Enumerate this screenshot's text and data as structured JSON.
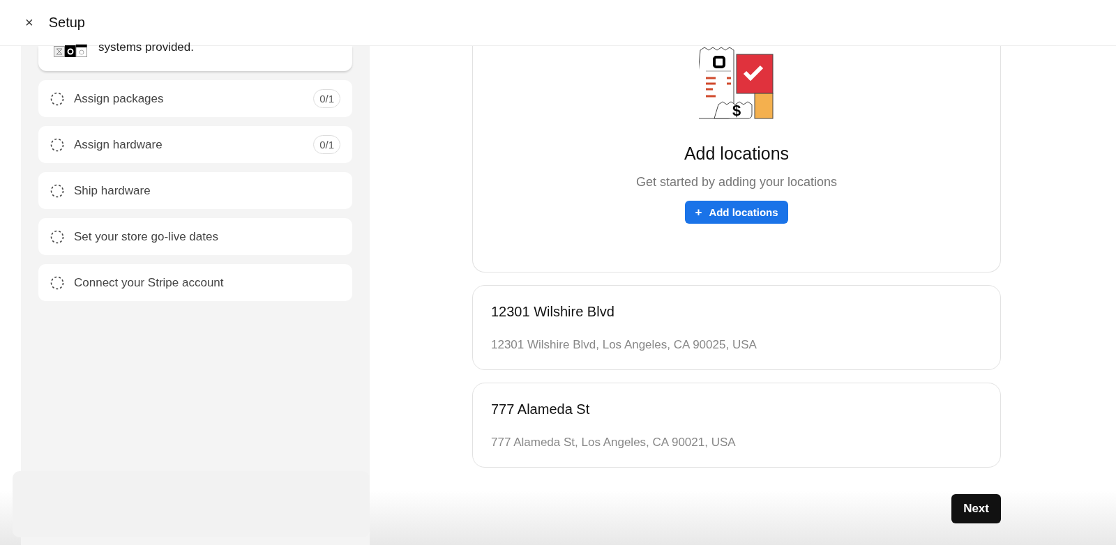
{
  "header": {
    "close": "×",
    "title": "Setup"
  },
  "top_card": {
    "text": "systems provided."
  },
  "steps": [
    {
      "label": "Assign packages",
      "count": "0/1"
    },
    {
      "label": "Assign hardware",
      "count": "0/1"
    },
    {
      "label": "Ship hardware"
    },
    {
      "label": "Set your store go-live dates"
    },
    {
      "label": "Connect your Stripe account"
    }
  ],
  "empty_state": {
    "illustration_symbol": "$",
    "title": "Add locations",
    "subtitle": "Get started by adding your locations",
    "button_icon": "+",
    "button": "Add locations"
  },
  "locations": [
    {
      "name": "12301 Wilshire Blvd",
      "address": "12301 Wilshire Blvd, Los Angeles, CA 90025, USA"
    },
    {
      "name": "777 Alameda St",
      "address": "777 Alameda St, Los Angeles, CA 90021, USA"
    }
  ],
  "footer": {
    "next": "Next"
  }
}
